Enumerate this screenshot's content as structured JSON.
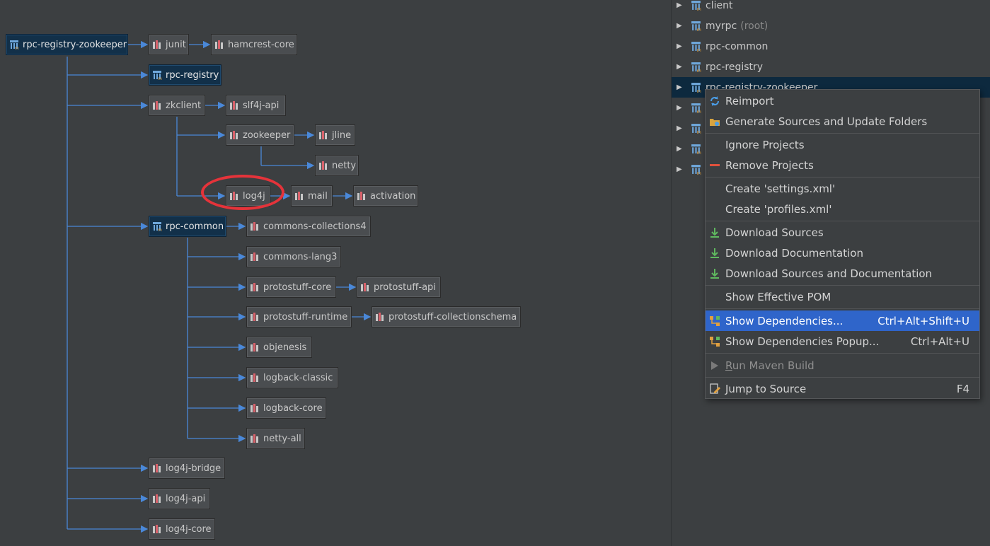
{
  "graph": {
    "nodes": {
      "root": "rpc-registry-zookeeper",
      "junit": "junit",
      "hamcrest": "hamcrest-core",
      "rpc_registry": "rpc-registry",
      "zkclient": "zkclient",
      "slf4j_api": "slf4j-api",
      "zookeeper": "zookeeper",
      "jline": "jline",
      "netty": "netty",
      "log4j": "log4j",
      "mail": "mail",
      "activation": "activation",
      "rpc_common": "rpc-common",
      "commons_collections4": "commons-collections4",
      "commons_lang3": "commons-lang3",
      "protostuff_core": "protostuff-core",
      "protostuff_api": "protostuff-api",
      "protostuff_runtime": "protostuff-runtime",
      "protostuff_collectionschema": "protostuff-collectionschema",
      "objenesis": "objenesis",
      "logback_classic": "logback-classic",
      "logback_core": "logback-core",
      "netty_all": "netty-all",
      "log4j_bridge": "log4j-bridge",
      "log4j_api": "log4j-api",
      "log4j_core": "log4j-core"
    },
    "highlighted": "log4j"
  },
  "project_tree": {
    "items": [
      {
        "label": "client",
        "suffix": ""
      },
      {
        "label": "myrpc",
        "suffix": "(root)"
      },
      {
        "label": "rpc-common",
        "suffix": ""
      },
      {
        "label": "rpc-registry",
        "suffix": ""
      },
      {
        "label": "rpc-registry-zookeeper",
        "suffix": ""
      }
    ],
    "selected_index": 4
  },
  "context_menu": {
    "reimport": "Reimport",
    "generate_sources": "Generate Sources and Update Folders",
    "ignore_projects": "Ignore Projects",
    "remove_projects": "Remove Projects",
    "create_settings": "Create 'settings.xml'",
    "create_profiles": "Create 'profiles.xml'",
    "download_sources": "Download Sources",
    "download_docs": "Download Documentation",
    "download_both": "Download Sources and Documentation",
    "show_effective_pom": "Show Effective POM",
    "show_dependencies": "Show Dependencies...",
    "show_dependencies_shortcut": "Ctrl+Alt+Shift+U",
    "show_dependencies_popup": "Show Dependencies Popup...",
    "show_dependencies_popup_shortcut": "Ctrl+Alt+U",
    "run_maven_mnemonic": "R",
    "run_maven_rest": "un Maven Build",
    "jump_to_source": "Jump to Source",
    "jump_to_source_shortcut": "F4"
  },
  "colors": {
    "edge": "#4a88d8",
    "highlight_circle": "#e5333a",
    "menu_active": "#2f65ca",
    "module_node": "#123049"
  }
}
